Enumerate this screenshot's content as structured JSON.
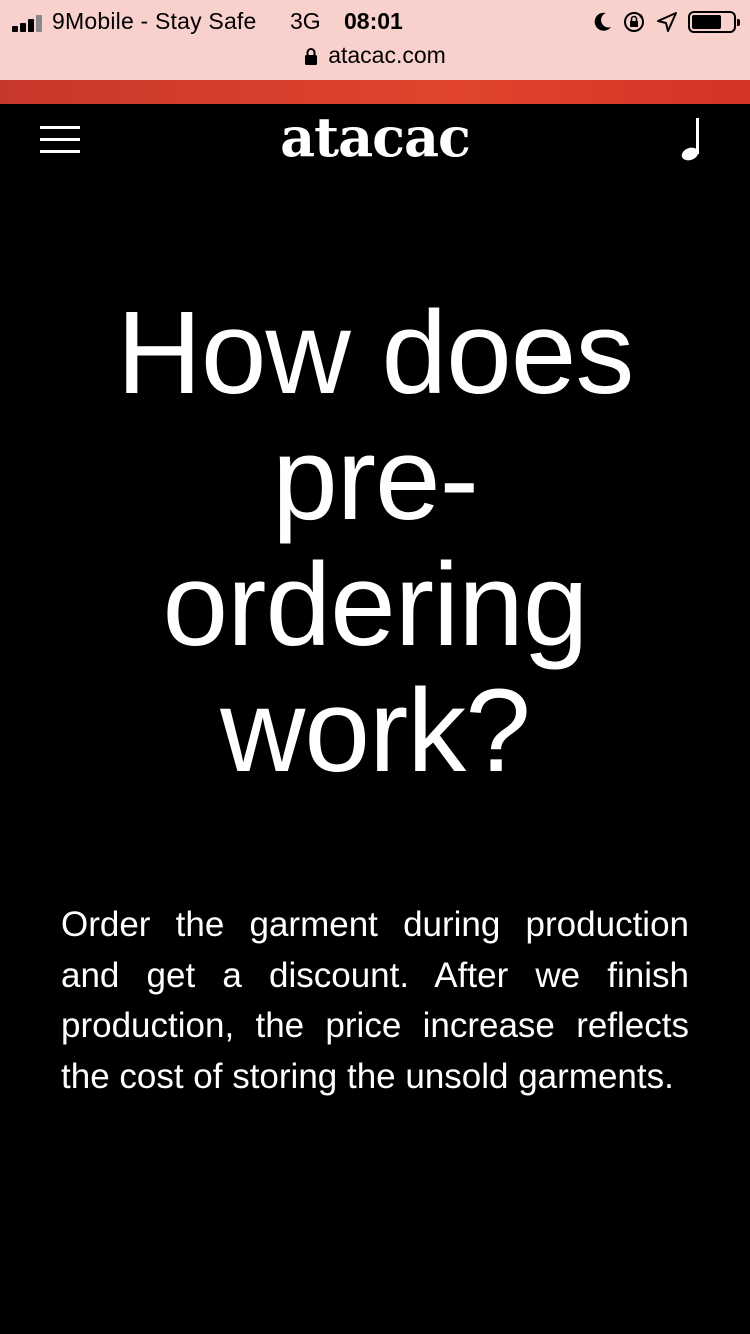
{
  "status_bar": {
    "carrier": "9Mobile - Stay Safe",
    "network": "3G",
    "time": "08:01",
    "battery_level": 0.72,
    "icons": [
      "signal-icon",
      "moon-icon",
      "rotation-lock-icon",
      "location-icon",
      "battery-icon"
    ]
  },
  "browser": {
    "url": "atacac.com",
    "load_progress": 1.0,
    "progress_color": "#dd3b2a"
  },
  "header": {
    "logo": "atacac",
    "menu_icon": "hamburger-menu-icon",
    "music_icon": "music-note-icon"
  },
  "main": {
    "headline": "How does pre-ordering work?",
    "body": "Order the garment during production and get a discount. After we finish production, the price increase reflects the cost of storing the unsold garments."
  },
  "colors": {
    "background": "#000000",
    "text": "#ffffff",
    "status_bar": "#f8d0cc"
  }
}
